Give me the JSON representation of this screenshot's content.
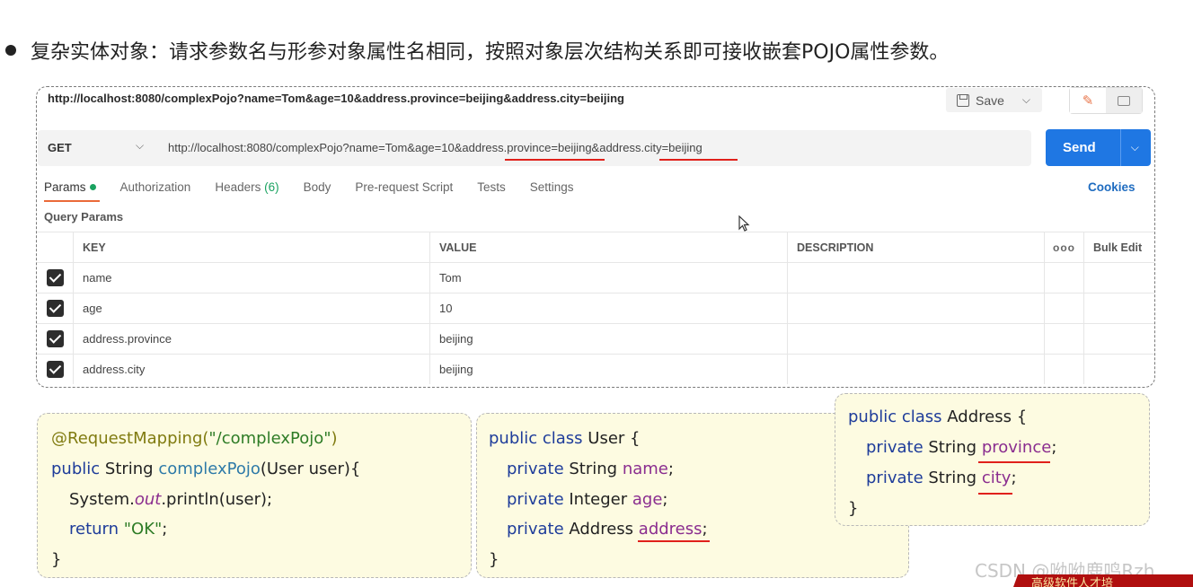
{
  "bullet": {
    "text": "复杂实体对象：请求参数名与形参对象属性名相同，按照对象层次结构关系即可接收嵌套POJO属性参数。"
  },
  "postman": {
    "title_url": "http://localhost:8080/complexPojo?name=Tom&age=10&address.province=beijing&address.city=beijing",
    "save_label": "Save",
    "method": "GET",
    "request_url": "http://localhost:8080/complexPojo?name=Tom&age=10&address.province=beijing&address.city=beijing",
    "send_label": "Send",
    "tabs": [
      {
        "label": "Params"
      },
      {
        "label": "Authorization"
      },
      {
        "label": "Headers",
        "count": "(6)"
      },
      {
        "label": "Body"
      },
      {
        "label": "Pre-request Script"
      },
      {
        "label": "Tests"
      },
      {
        "label": "Settings"
      }
    ],
    "cookies_label": "Cookies",
    "query_params_label": "Query Params",
    "table": {
      "headers": [
        "KEY",
        "VALUE",
        "DESCRIPTION",
        "Bulk Edit"
      ],
      "rows": [
        {
          "key": "name",
          "value": "Tom"
        },
        {
          "key": "age",
          "value": "10"
        },
        {
          "key": "address.province",
          "value": "beijing"
        },
        {
          "key": "address.city",
          "value": "beijing"
        }
      ]
    }
  },
  "code": {
    "controller": {
      "annotation": "@RequestMapping(",
      "annotation_str": "\"/complexPojo\"",
      "annotation_close": ")",
      "kw_public": "public",
      "sig_type": " String ",
      "method_name": "complexPojo",
      "sig_params": "(User user){",
      "println_a": "System.",
      "println_out": "out",
      "println_b": ".println(user);",
      "ret_kw": "return ",
      "ret_str": "\"OK\"",
      "ret_end": ";",
      "close": "}"
    },
    "user": {
      "decl_kw": "public class",
      "decl_name": " User {",
      "f1_kw": "private",
      "f1_type": " String ",
      "f1_name": "name",
      "f2_kw": "private",
      "f2_type": " Integer ",
      "f2_name": "age",
      "f3_kw": "private",
      "f3_type": " Address ",
      "f3_name": "address",
      "semi": ";",
      "close": "}"
    },
    "address": {
      "decl_kw": "public class",
      "decl_name": " Address {",
      "f1_kw": "private",
      "f1_type": " String ",
      "f1_name": "province",
      "f2_kw": "private",
      "f2_type": " String ",
      "f2_name": "city",
      "semi": ";",
      "close": "}"
    }
  },
  "watermark": "CSDN @呦呦鹿鸣Rzh",
  "corner_text": "高级软件人才培"
}
